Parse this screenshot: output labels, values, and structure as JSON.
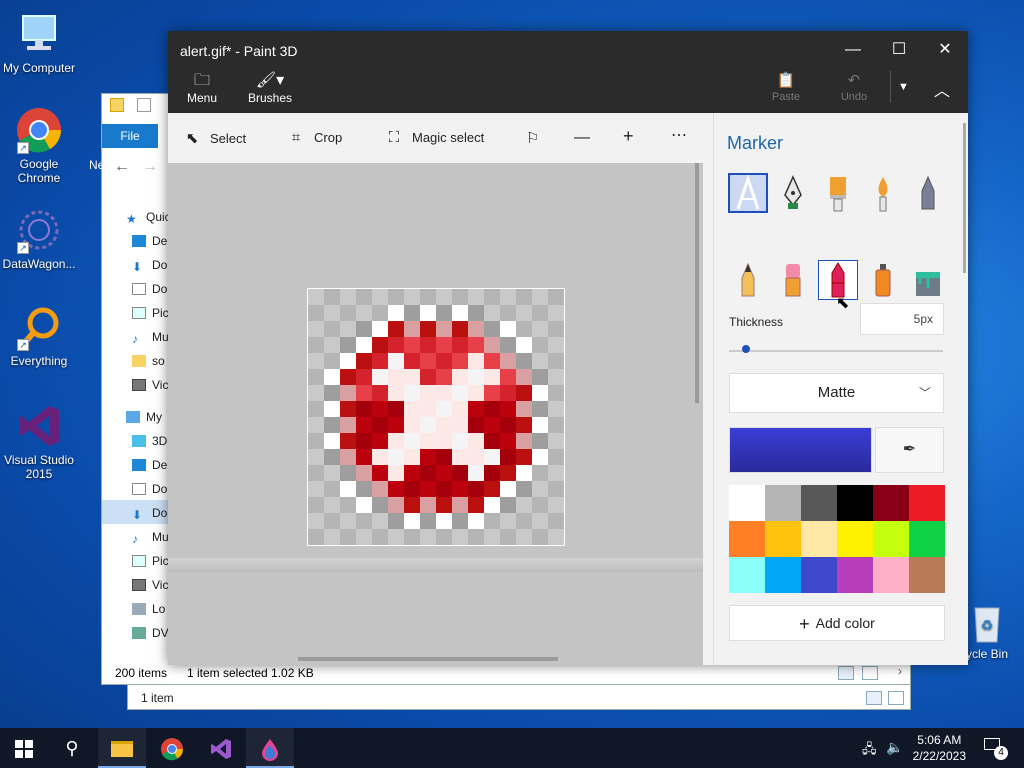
{
  "desktop": {
    "icons": [
      {
        "label": "My Computer"
      },
      {
        "label": "Google Chrome"
      },
      {
        "label": "DataWagon..."
      },
      {
        "label": "Everything"
      },
      {
        "label": "Visual Studio 2015"
      },
      {
        "label": "ycle Bin"
      }
    ]
  },
  "explorer": {
    "file_tab": "File",
    "truncated_label": "Ne",
    "nav_items": [
      "Quic",
      "De",
      "Do",
      "Do",
      "Pic",
      "Mu",
      "so",
      "Vic",
      "My",
      "3D",
      "De",
      "Do",
      "Do",
      "Mu",
      "Pic",
      "Vic",
      "Lo",
      "DV"
    ],
    "status_items": "200 items",
    "status_selected": "1 item selected  1.02 KB",
    "status2": "1 item"
  },
  "paint": {
    "title": "alert.gif* - Paint 3D",
    "menu_label": "Menu",
    "brushes_label": "Brushes",
    "paste_label": "Paste",
    "undo_label": "Undo",
    "tools": {
      "select": "Select",
      "crop": "Crop",
      "magic_select": "Magic select"
    },
    "panel": {
      "heading": "Marker",
      "thickness_label": "Thickness",
      "thickness_value": "5px",
      "thickness_fraction": 0.04,
      "finish": "Matte",
      "add_color": "Add color",
      "current_color": "#3a3ed6",
      "swatches": [
        "#ffffff",
        "#b4b4b4",
        "#585858",
        "#000000",
        "#880015",
        "#ed1c24",
        "#ff7f27",
        "#ffc20e",
        "#ffe8a5",
        "#fff200",
        "#c4ff0e",
        "#0ed145",
        "#8cfffb",
        "#00a8f3",
        "#3f48cc",
        "#b83dba",
        "#ffaec8",
        "#b97a57"
      ]
    }
  },
  "taskbar": {
    "time": "5:06 AM",
    "date": "2/22/2023",
    "notifications": "4"
  }
}
